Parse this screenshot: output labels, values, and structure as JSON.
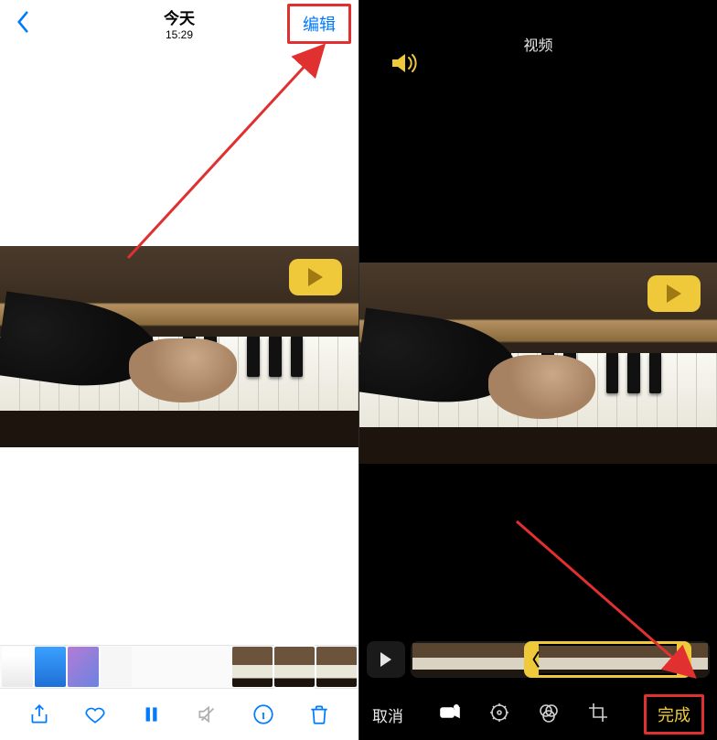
{
  "left": {
    "title": "今天",
    "subtitle": "15:29",
    "edit_label": "编辑",
    "toolbar": {
      "share": "share",
      "favorite": "favorite",
      "pause": "pause",
      "mute": "mute",
      "info": "info",
      "trash": "trash"
    }
  },
  "right": {
    "header_title": "视频",
    "cancel_label": "取消",
    "done_label": "完成"
  },
  "colors": {
    "ios_blue": "#007aff",
    "accent_yellow": "#f0c93a",
    "annotation_red": "#e03030"
  }
}
